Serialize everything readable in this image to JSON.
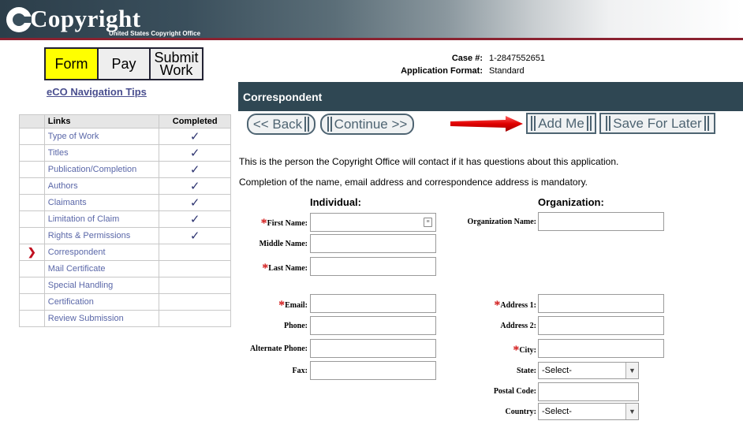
{
  "header": {
    "logo_text": "Copyright",
    "logo_subtitle": "United States Copyright Office"
  },
  "tabs": {
    "form": "Form",
    "pay": "Pay",
    "submit_line1": "Submit",
    "submit_line2": "Work"
  },
  "nav_tips": "eCO Navigation Tips",
  "links_table": {
    "col_links": "Links",
    "col_completed": "Completed",
    "check_glyph": "✓",
    "current_glyph": "❯",
    "rows": [
      {
        "label": "Type of Work",
        "completed": true
      },
      {
        "label": "Titles",
        "completed": true
      },
      {
        "label": "Publication/Completion",
        "completed": true
      },
      {
        "label": "Authors",
        "completed": true
      },
      {
        "label": "Claimants",
        "completed": true
      },
      {
        "label": "Limitation of Claim",
        "completed": true
      },
      {
        "label": "Rights & Permissions",
        "completed": true
      },
      {
        "label": "Correspondent",
        "completed": false,
        "current": true
      },
      {
        "label": "Mail Certificate",
        "completed": false
      },
      {
        "label": "Special Handling",
        "completed": false
      },
      {
        "label": "Certification",
        "completed": false
      },
      {
        "label": "Review Submission",
        "completed": false
      }
    ]
  },
  "case": {
    "case_label": "Case #:",
    "case_value": "1-2847552651",
    "format_label": "Application Format:",
    "format_value": "Standard"
  },
  "section_title": "Correspondent",
  "buttons": {
    "back": "<< Back",
    "continue": "Continue >>",
    "add_me": "Add Me",
    "save_later": "Save For Later"
  },
  "intro": {
    "line1": "This is the person the Copyright Office will contact if it has questions about this application.",
    "line2": "Completion of the name, email address and correspondence address is mandatory."
  },
  "individual": {
    "heading": "Individual:",
    "first_name": "First Name:",
    "middle_name": "Middle Name:",
    "last_name": "Last Name:",
    "email": "Email:",
    "phone": "Phone:",
    "alt_phone": "Alternate Phone:",
    "fax": "Fax:"
  },
  "organization": {
    "heading": "Organization:",
    "org_name": "Organization Name:",
    "address1": "Address 1:",
    "address2": "Address 2:",
    "city": "City:",
    "state": "State:",
    "state_value": "-Select-",
    "postal": "Postal Code:",
    "country": "Country:",
    "country_value": "-Select-"
  },
  "required_marker": "*",
  "colors": {
    "banner_dark": "#2c3e4a",
    "section_bg": "#2f4753",
    "tab_active": "#ffff00",
    "link": "#5a67a8",
    "required": "#d01010"
  }
}
